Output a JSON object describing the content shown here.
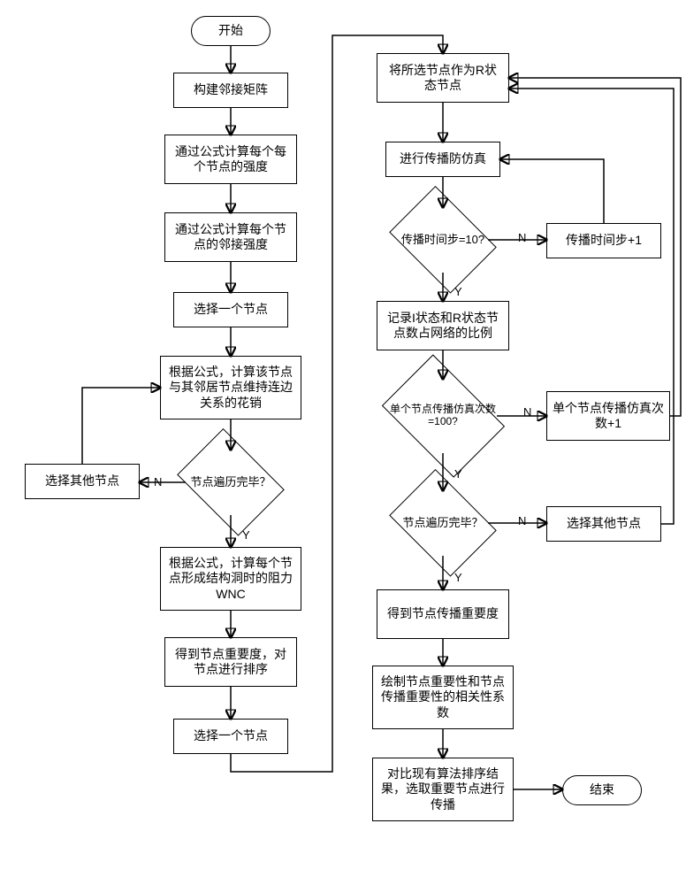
{
  "chart_data": {
    "type": "flowchart",
    "title": "",
    "nodes": [
      {
        "id": "start",
        "type": "terminator",
        "label": "开始"
      },
      {
        "id": "n_adj",
        "type": "process",
        "label": "构建邻接矩阵"
      },
      {
        "id": "n_strength",
        "type": "process",
        "label": "通过公式计算每个每个节点的强度"
      },
      {
        "id": "n_neigh_strength",
        "type": "process",
        "label": "通过公式计算每个节点的邻接强度"
      },
      {
        "id": "n_select1",
        "type": "process",
        "label": "选择一个节点"
      },
      {
        "id": "n_cost",
        "type": "process",
        "label": "根据公式，计算该节点与其邻居节点维持连边关系的花销"
      },
      {
        "id": "d_trav1",
        "type": "decision",
        "label": "节点遍历完毕？"
      },
      {
        "id": "n_select_other_left",
        "type": "process",
        "label": "选择其他节点"
      },
      {
        "id": "n_wnc",
        "type": "process",
        "label": "根据公式，计算每个节点形成结构洞时的阻力WNC"
      },
      {
        "id": "n_rank",
        "type": "process",
        "label": "得到节点重要度，对节点进行排序"
      },
      {
        "id": "n_select2",
        "type": "process",
        "label": "选择一个节点"
      },
      {
        "id": "n_Rstate",
        "type": "process",
        "label": "将所选节点作为R状态节点"
      },
      {
        "id": "n_sim",
        "type": "process",
        "label": "进行传播防仿真"
      },
      {
        "id": "d_step10",
        "type": "decision",
        "label": "传播时间步=10?"
      },
      {
        "id": "n_step_inc",
        "type": "process",
        "label": "传播时间步+1"
      },
      {
        "id": "n_record",
        "type": "process",
        "label": "记录I状态和R状态节点数占网络的比例"
      },
      {
        "id": "d_sim100",
        "type": "decision",
        "label": "单个节点传播仿真次数=100?"
      },
      {
        "id": "n_sim_inc",
        "type": "process",
        "label": "单个节点传播仿真次数+1"
      },
      {
        "id": "d_trav2",
        "type": "decision",
        "label": "节点遍历完毕？"
      },
      {
        "id": "n_select_other_right",
        "type": "process",
        "label": "选择其他节点"
      },
      {
        "id": "n_spread_imp",
        "type": "process",
        "label": "得到节点传播重要度"
      },
      {
        "id": "n_corr",
        "type": "process",
        "label": "绘制节点重要性和节点传播重要性的相关性系数"
      },
      {
        "id": "n_compare",
        "type": "process",
        "label": "对比现有算法排序结果，选取重要节点进行传播"
      },
      {
        "id": "end",
        "type": "terminator",
        "label": "结束"
      }
    ],
    "edges": [
      {
        "from": "start",
        "to": "n_adj"
      },
      {
        "from": "n_adj",
        "to": "n_strength"
      },
      {
        "from": "n_strength",
        "to": "n_neigh_strength"
      },
      {
        "from": "n_neigh_strength",
        "to": "n_select1"
      },
      {
        "from": "n_select1",
        "to": "n_cost"
      },
      {
        "from": "n_cost",
        "to": "d_trav1"
      },
      {
        "from": "d_trav1",
        "to": "n_select_other_left",
        "label": "N"
      },
      {
        "from": "n_select_other_left",
        "to": "n_cost"
      },
      {
        "from": "d_trav1",
        "to": "n_wnc",
        "label": "Y"
      },
      {
        "from": "n_wnc",
        "to": "n_rank"
      },
      {
        "from": "n_rank",
        "to": "n_select2"
      },
      {
        "from": "n_select2",
        "to": "n_Rstate"
      },
      {
        "from": "n_Rstate",
        "to": "n_sim"
      },
      {
        "from": "n_sim",
        "to": "d_step10"
      },
      {
        "from": "d_step10",
        "to": "n_step_inc",
        "label": "N"
      },
      {
        "from": "n_step_inc",
        "to": "n_sim"
      },
      {
        "from": "d_step10",
        "to": "n_record",
        "label": "Y"
      },
      {
        "from": "n_record",
        "to": "d_sim100"
      },
      {
        "from": "d_sim100",
        "to": "n_sim_inc",
        "label": "N"
      },
      {
        "from": "n_sim_inc",
        "to": "n_Rstate"
      },
      {
        "from": "d_sim100",
        "to": "d_trav2",
        "label": "Y"
      },
      {
        "from": "d_trav2",
        "to": "n_select_other_right",
        "label": "N"
      },
      {
        "from": "n_select_other_right",
        "to": "n_Rstate"
      },
      {
        "from": "d_trav2",
        "to": "n_spread_imp",
        "label": "Y"
      },
      {
        "from": "n_spread_imp",
        "to": "n_corr"
      },
      {
        "from": "n_corr",
        "to": "n_compare"
      },
      {
        "from": "n_compare",
        "to": "end"
      }
    ],
    "edge_labels": {
      "yes": "Y",
      "no": "N"
    }
  }
}
